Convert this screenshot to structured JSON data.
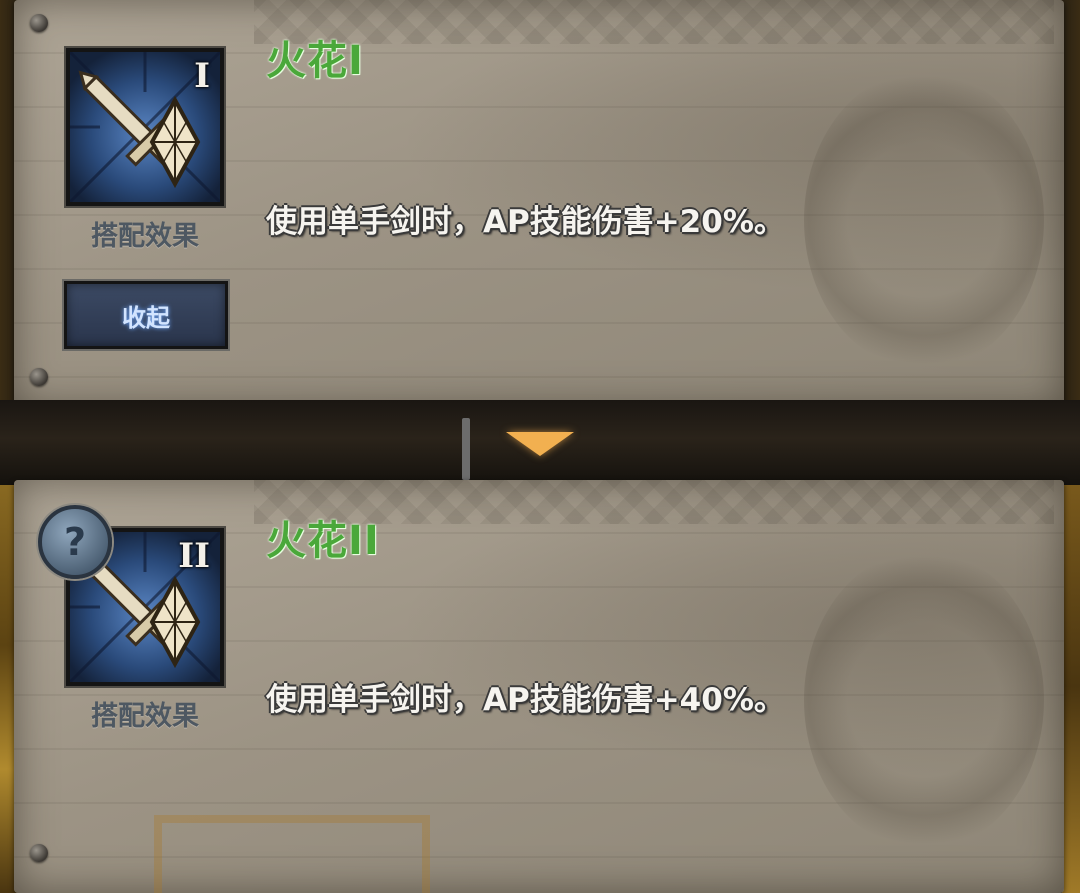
{
  "cards": [
    {
      "title": "火花I",
      "roman": "I",
      "caption": "搭配效果",
      "description": "使用单手剑时，AP技能伤害+20%。",
      "icon": "sword-crystal-icon",
      "button_label": "收起"
    },
    {
      "title": "火花II",
      "roman": "II",
      "caption": "搭配效果",
      "description": "使用单手剑时，AP技能伤害+40%。",
      "icon": "sword-crystal-icon",
      "help_label": "?"
    }
  ],
  "colors": {
    "title_green": "#4aa83a",
    "icon_bg": "#1a2a44",
    "arrow": "#f2b050"
  }
}
